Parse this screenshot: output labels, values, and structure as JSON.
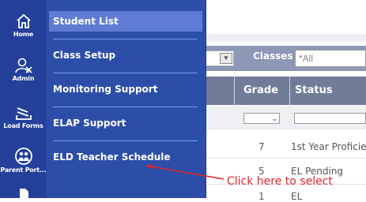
{
  "rail": {
    "items": [
      {
        "label": "Home",
        "icon": "home-icon"
      },
      {
        "label": "Admin",
        "icon": "admin-icon"
      },
      {
        "label": "Load Forms",
        "icon": "load-forms-icon"
      },
      {
        "label": "Parent Port...",
        "icon": "parent-portal-icon"
      }
    ]
  },
  "menu": {
    "items": [
      {
        "label": "Student List",
        "active": true
      },
      {
        "label": "Class Setup",
        "active": false
      },
      {
        "label": "Monitoring Support",
        "active": false
      },
      {
        "label": "ELAP Support",
        "active": false
      },
      {
        "label": "ELD Teacher Schedule",
        "active": false
      }
    ]
  },
  "filters": {
    "classes_label": "Classes",
    "classes_placeholder": "*All"
  },
  "table": {
    "columns": [
      "Grade",
      "Status"
    ],
    "rows": [
      {
        "grade": "7",
        "status": "1st Year Proficie"
      },
      {
        "grade": "5",
        "status": "EL Pending"
      },
      {
        "grade": "1",
        "status": "EL"
      }
    ]
  },
  "annotation": {
    "text": "Click here to select",
    "color": "#e0242a"
  },
  "colors": {
    "rail": "#25409a",
    "menu": "#2d4ea8",
    "menu_active": "#5f7bd3",
    "separator": "#6f9cf0",
    "header_row": "#717c99"
  }
}
